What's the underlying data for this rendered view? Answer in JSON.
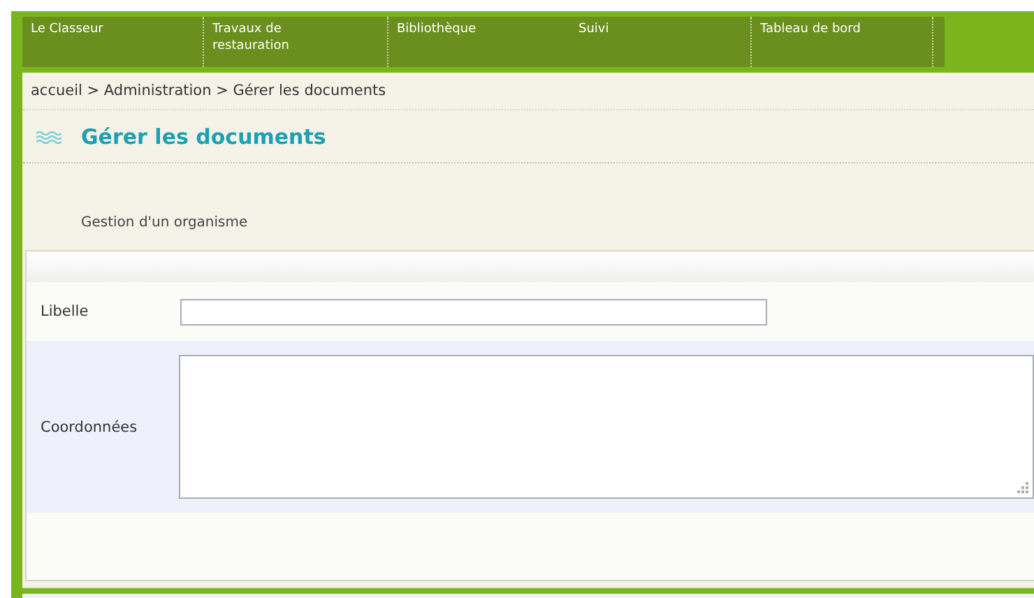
{
  "nav": [
    {
      "label": "Le Classeur",
      "divider": true
    },
    {
      "label": "Travaux de restauration",
      "divider": true
    },
    {
      "label": "Bibliothèque",
      "divider": false
    },
    {
      "label": "Suivi",
      "divider": true
    },
    {
      "label": "Tableau de bord",
      "divider": true
    }
  ],
  "breadcrumb": "accueil > Administration > Gérer les documents",
  "title": "Gérer les documents",
  "subtitle": "Gestion d'un organisme",
  "form": {
    "fields": [
      {
        "label": "Libelle",
        "kind": "text"
      },
      {
        "label": "Coordonnées",
        "kind": "textarea"
      }
    ]
  }
}
